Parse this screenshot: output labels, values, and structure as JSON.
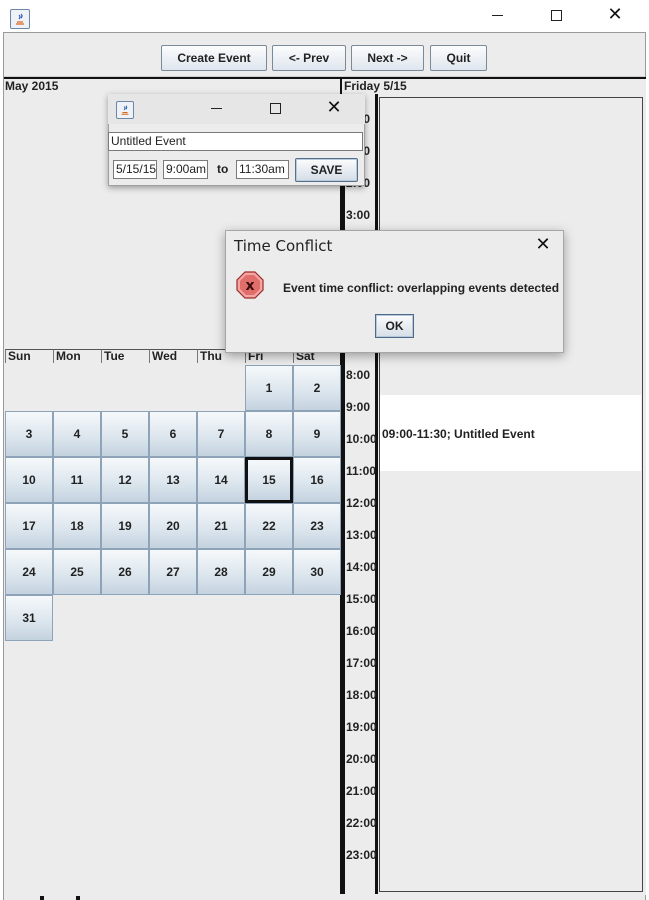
{
  "toolbar": {
    "create_event": "Create Event",
    "prev": "<- Prev",
    "next": "Next ->",
    "quit": "Quit"
  },
  "month": {
    "title": "May 2015",
    "day_names": [
      "Sun",
      "Mon",
      "Tue",
      "Wed",
      "Thu",
      "Fri",
      "Sat"
    ],
    "days": [
      "1",
      "2",
      "3",
      "4",
      "5",
      "6",
      "7",
      "8",
      "9",
      "10",
      "11",
      "12",
      "13",
      "14",
      "15",
      "16",
      "17",
      "18",
      "19",
      "20",
      "21",
      "22",
      "23",
      "24",
      "25",
      "26",
      "27",
      "28",
      "29",
      "30",
      "31"
    ],
    "selected_day": "15"
  },
  "day_view": {
    "title": "Friday 5/15",
    "hours": [
      "0:00",
      "1:00",
      "2:00",
      "3:00",
      "8:00",
      "9:00",
      "10:00",
      "11:00",
      "12:00",
      "13:00",
      "14:00",
      "15:00",
      "16:00",
      "17:00",
      "18:00",
      "19:00",
      "20:00",
      "21:00",
      "22:00",
      "23:00"
    ],
    "event_text": "09:00-11:30; Untitled Event"
  },
  "create_dialog": {
    "name_value": "Untitled Event",
    "date_value": "5/15/15",
    "start_value": "9:00am",
    "to_label": "to",
    "end_value": "11:30am",
    "save_label": "SAVE"
  },
  "conflict_dialog": {
    "title": "Time Conflict",
    "message": "Event time conflict: overlapping events detected",
    "ok_label": "OK"
  },
  "colors": {
    "cell_top": "#f6f9fb",
    "cell_bottom": "#c4d3e0",
    "cell_border": "#8ea2b8",
    "error_icon": "#d9534f"
  }
}
